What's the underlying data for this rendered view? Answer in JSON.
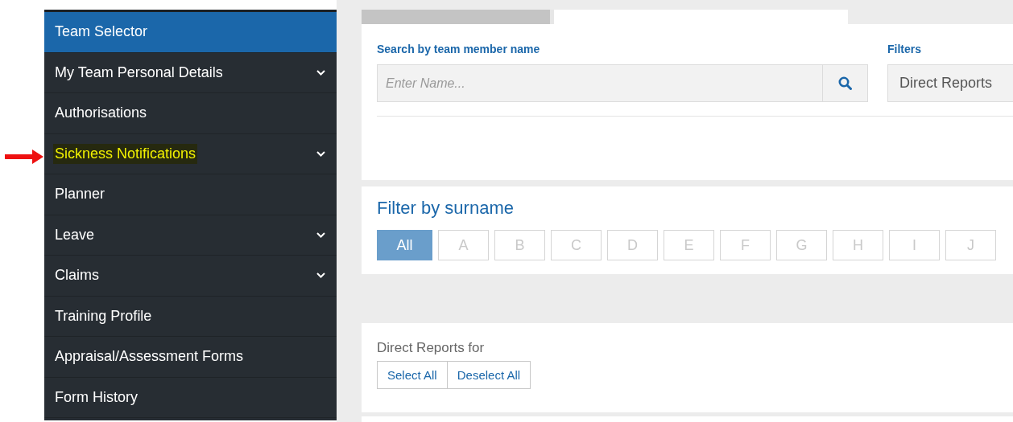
{
  "sidebar": {
    "items": [
      {
        "label": "Team Selector",
        "selected": true,
        "expandable": false,
        "highlighted": false
      },
      {
        "label": "My Team Personal Details",
        "selected": false,
        "expandable": true,
        "highlighted": false
      },
      {
        "label": "Authorisations",
        "selected": false,
        "expandable": false,
        "highlighted": false
      },
      {
        "label": "Sickness Notifications",
        "selected": false,
        "expandable": true,
        "highlighted": true
      },
      {
        "label": "Planner",
        "selected": false,
        "expandable": false,
        "highlighted": false
      },
      {
        "label": "Leave",
        "selected": false,
        "expandable": true,
        "highlighted": false
      },
      {
        "label": "Claims",
        "selected": false,
        "expandable": true,
        "highlighted": false
      },
      {
        "label": "Training Profile",
        "selected": false,
        "expandable": false,
        "highlighted": false
      },
      {
        "label": "Appraisal/Assessment Forms",
        "selected": false,
        "expandable": false,
        "highlighted": false
      },
      {
        "label": "Form History",
        "selected": false,
        "expandable": false,
        "highlighted": false
      }
    ]
  },
  "search": {
    "label": "Search by team member name",
    "placeholder": "Enter Name..."
  },
  "filters": {
    "label": "Filters",
    "value": "Direct Reports"
  },
  "surname_filter": {
    "title": "Filter by surname",
    "letters": [
      {
        "label": "All",
        "selected": true
      },
      {
        "label": "A",
        "selected": false
      },
      {
        "label": "B",
        "selected": false
      },
      {
        "label": "C",
        "selected": false
      },
      {
        "label": "D",
        "selected": false
      },
      {
        "label": "E",
        "selected": false
      },
      {
        "label": "F",
        "selected": false
      },
      {
        "label": "G",
        "selected": false
      },
      {
        "label": "H",
        "selected": false
      },
      {
        "label": "I",
        "selected": false
      },
      {
        "label": "J",
        "selected": false
      }
    ]
  },
  "direct_reports": {
    "title": "Direct Reports for",
    "buttons": [
      "Select All",
      "Deselect All"
    ]
  }
}
